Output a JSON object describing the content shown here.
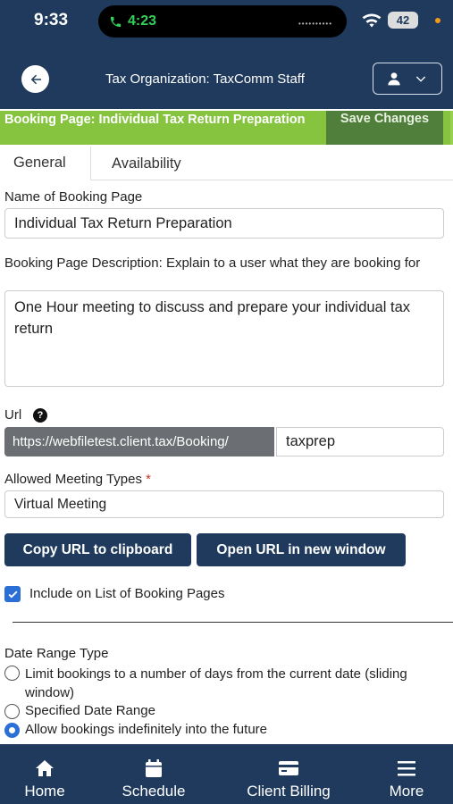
{
  "status_bar": {
    "time": "9:33",
    "call_time": "4:23",
    "battery": "42"
  },
  "header": {
    "title": "Tax Organization: TaxComm Staff"
  },
  "page": {
    "title": "Booking Page: Individual Tax Return Preparation",
    "save_label": "Save Changes"
  },
  "tabs": [
    {
      "label": "General",
      "active": true
    },
    {
      "label": "Availability",
      "active": false
    }
  ],
  "form": {
    "name_label": "Name of Booking Page",
    "name_value": "Individual Tax Return Preparation",
    "description_label": "Booking Page Description: Explain to a user what they are booking for",
    "description_value": "One Hour meeting to discuss and prepare your individual tax return",
    "url_label": "Url",
    "url_help_glyph": "?",
    "url_prefix": "https://webfiletest.client.tax/Booking/",
    "url_value": "taxprep",
    "meeting_types_label": "Allowed Meeting Types",
    "required_mark": "*",
    "meeting_types_value": "Virtual Meeting",
    "copy_url_label": "Copy URL to clipboard",
    "open_url_label": "Open URL in new window",
    "include_list_label": "Include on List of Booking Pages",
    "include_list_checked": true,
    "date_range_label": "Date Range Type",
    "date_range_options": [
      {
        "label": "Limit bookings to a number of days from the current date (sliding window)",
        "checked": false
      },
      {
        "label": "Specified Date Range",
        "checked": false
      },
      {
        "label": "Allow bookings indefinitely into the future",
        "checked": true
      }
    ]
  },
  "bottom_nav": [
    {
      "label": "Home",
      "icon": "home-icon"
    },
    {
      "label": "Schedule",
      "icon": "calendar-icon"
    },
    {
      "label": "Client Billing",
      "icon": "credit-card-icon"
    },
    {
      "label": "More",
      "icon": "menu-icon"
    }
  ],
  "colors": {
    "header_bg": "#1f3a5c",
    "page_header_bg": "#86c440",
    "save_button_bg": "#4f7f3a",
    "accent_blue": "#2a6fd6"
  }
}
